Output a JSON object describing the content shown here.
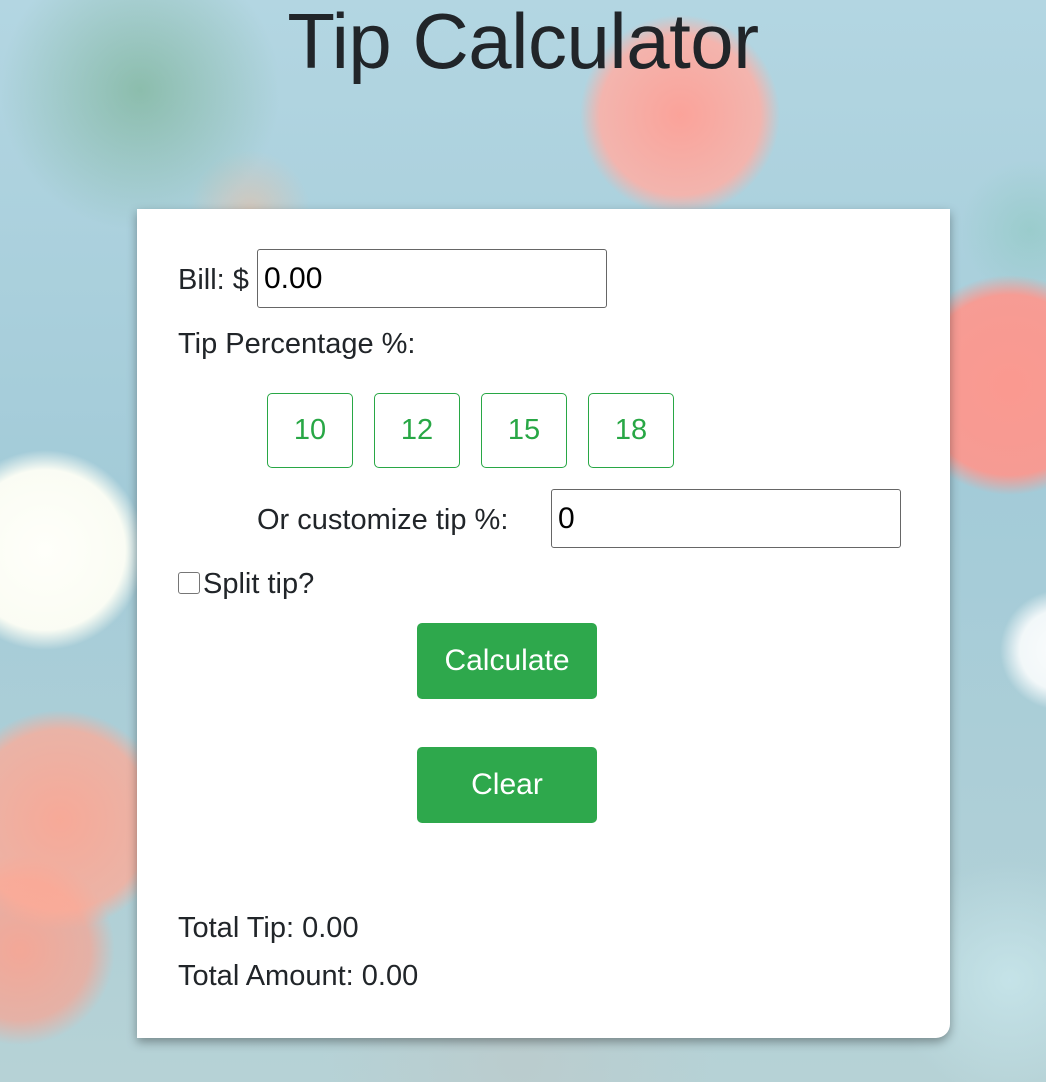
{
  "app": {
    "title": "Tip Calculator"
  },
  "bill": {
    "label": "Bill: $",
    "value": "0.00"
  },
  "tip": {
    "label": "Tip Percentage %:",
    "options": [
      "10",
      "12",
      "15",
      "18"
    ],
    "custom_label": "Or customize tip %:",
    "custom_value": "0"
  },
  "split": {
    "label": "Split tip?",
    "checked": false
  },
  "actions": {
    "calculate_label": "Calculate",
    "clear_label": "Clear"
  },
  "results": {
    "total_tip_label": "Total Tip:",
    "total_tip_value": "0.00",
    "total_amount_label": "Total Amount:",
    "total_amount_value": "0.00"
  },
  "colors": {
    "accent": "#28a745",
    "button_fill": "#2ea84c",
    "text": "#212529"
  }
}
